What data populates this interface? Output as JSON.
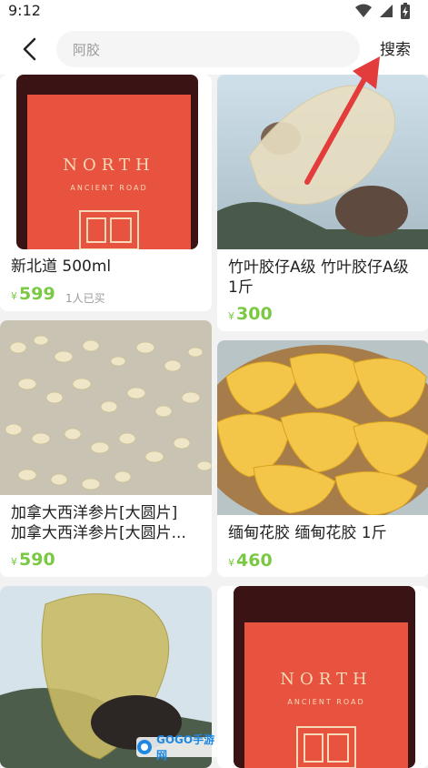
{
  "status_bar": {
    "time": "9:12"
  },
  "header": {
    "search_query": "阿胶",
    "search_button": "搜索"
  },
  "products": [
    {
      "title": "新北道 500ml",
      "currency": "¥",
      "price": "599",
      "sold": "1人已买"
    },
    {
      "title": "竹叶胶仔A级 竹叶胶仔A级 1斤",
      "currency": "¥",
      "price": "300"
    },
    {
      "title": "加拿大西洋参片[大圆片] 加拿大西洋参片[大圆片...",
      "title_line1": "加拿大西洋参片[大圆片]",
      "title_line2": "加拿大西洋参片[大圆片...",
      "currency": "¥",
      "price": "590"
    },
    {
      "title": "缅甸花胶 缅甸花胶 1斤",
      "currency": "¥",
      "price": "460"
    }
  ],
  "bottle_label": {
    "brand": "NORTH",
    "tagline": "ANCIENT ROAD"
  },
  "watermark": {
    "text": "GOGO手游网"
  },
  "colors": {
    "price": "#7ac943",
    "arrow": "#e23c3c",
    "label_red": "#e8533f"
  }
}
